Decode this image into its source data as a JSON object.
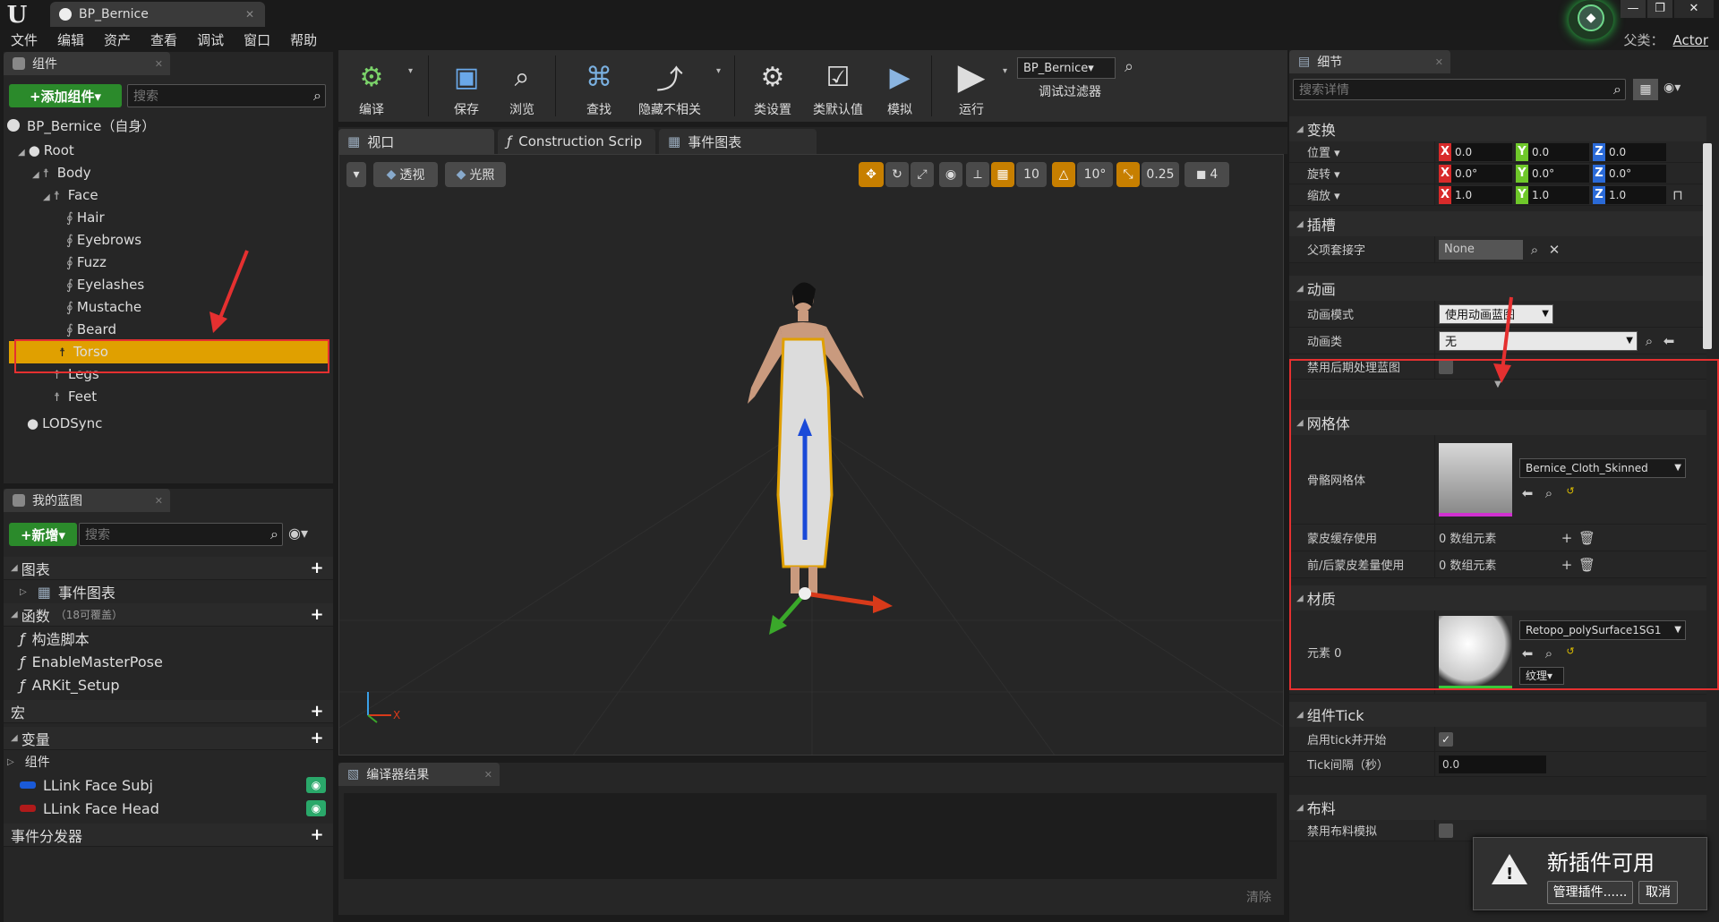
{
  "doc_tab": "BP_Bernice",
  "menu": [
    "文件",
    "编辑",
    "资产",
    "查看",
    "调试",
    "窗口",
    "帮助"
  ],
  "parent_class": {
    "label": "父类：",
    "value": "Actor"
  },
  "components_panel": {
    "tab": "组件",
    "add_button": "+添加组件▾",
    "search_placeholder": "搜索",
    "self_item": "BP_Bernice（自身）",
    "tree": [
      {
        "label": "Root",
        "depth": 0,
        "kind": "root"
      },
      {
        "label": "Body",
        "depth": 1,
        "kind": "bone"
      },
      {
        "label": "Face",
        "depth": 2,
        "kind": "bone"
      },
      {
        "label": "Hair",
        "depth": 3,
        "kind": "cloth"
      },
      {
        "label": "Eyebrows",
        "depth": 3,
        "kind": "cloth"
      },
      {
        "label": "Fuzz",
        "depth": 3,
        "kind": "cloth"
      },
      {
        "label": "Eyelashes",
        "depth": 3,
        "kind": "cloth"
      },
      {
        "label": "Mustache",
        "depth": 3,
        "kind": "cloth"
      },
      {
        "label": "Beard",
        "depth": 3,
        "kind": "cloth"
      },
      {
        "label": "Torso",
        "depth": 2,
        "kind": "bone"
      },
      {
        "label": "Legs",
        "depth": 2,
        "kind": "bone"
      },
      {
        "label": "Feet",
        "depth": 2,
        "kind": "bone"
      }
    ],
    "lodsync": "LODSync"
  },
  "blueprint_panel": {
    "tab": "我的蓝图",
    "new_button": "+新增▾",
    "search_placeholder": "搜索",
    "graphs": "图表",
    "event_graph": "事件图表",
    "functions": "函数",
    "functions_note": "（18可覆盖）",
    "construct_script": "构造脚本",
    "fn1": "EnableMasterPose",
    "fn2": "ARKit_Setup",
    "macros": "宏",
    "variables": "变量",
    "components_group": "组件",
    "var1": "LLink Face Subj",
    "var2": "LLink Face Head",
    "dispatchers": "事件分发器"
  },
  "toolbar": {
    "buttons": [
      "编译",
      "保存",
      "浏览",
      "查找",
      "隐藏不相关",
      "类设置",
      "类默认值",
      "模拟",
      "运行"
    ],
    "debug_select": "BP_Bernice▾",
    "debug_filter": "调试过滤器"
  },
  "editor_tabs": [
    "视口",
    "Construction Scrip",
    "事件图表"
  ],
  "viewport": {
    "perspective": "透视",
    "lighting": "光照",
    "grid": "10",
    "rotate": "10°",
    "scale": "0.25",
    "camera_speed": "4"
  },
  "compiler": {
    "tab": "编译器结果",
    "clear": "清除"
  },
  "details": {
    "tab": "细节",
    "search_placeholder": "搜索详情",
    "transform": {
      "title": "变换",
      "location": "位置 ▾",
      "rotation": "旋转 ▾",
      "scale": "缩放 ▾",
      "loc": [
        "0.0",
        "0.0",
        "0.0"
      ],
      "rot": [
        "0.0°",
        "0.0°",
        "0.0°"
      ],
      "scl": [
        "1.0",
        "1.0",
        "1.0"
      ]
    },
    "sockets": {
      "title": "插槽",
      "parent_socket": "父项套接字",
      "value": "None"
    },
    "animation": {
      "title": "动画",
      "mode_label": "动画模式",
      "mode_value": "使用动画蓝图",
      "class_label": "动画类",
      "class_value": "无",
      "disable_post": "禁用后期处理蓝图"
    },
    "mesh": {
      "title": "网格体",
      "skeletal_label": "骨骼网格体",
      "skeletal_value": "Bernice_Cloth_Skinned",
      "skin_cache": "蒙皮缓存使用",
      "skin_cache_val": "0 数组元素",
      "morph": "前/后蒙皮差量使用",
      "morph_val": "0 数组元素"
    },
    "materials": {
      "title": "材质",
      "element0": "元素 0",
      "material_value": "Retopo_polySurface1SG1",
      "texture": "纹理▾"
    },
    "tick": {
      "title": "组件Tick",
      "start": "启用tick并开始",
      "interval": "Tick间隔（秒）",
      "interval_val": "0.0"
    },
    "cloth": {
      "title": "布料",
      "disable": "禁用布料模拟"
    }
  },
  "notification": {
    "title": "新插件可用",
    "manage": "管理插件......",
    "cancel": "取消"
  },
  "colors": {
    "accent_orange": "#e0a000",
    "add_green": "#2b8a2b",
    "highlight_red": "#e53030"
  }
}
